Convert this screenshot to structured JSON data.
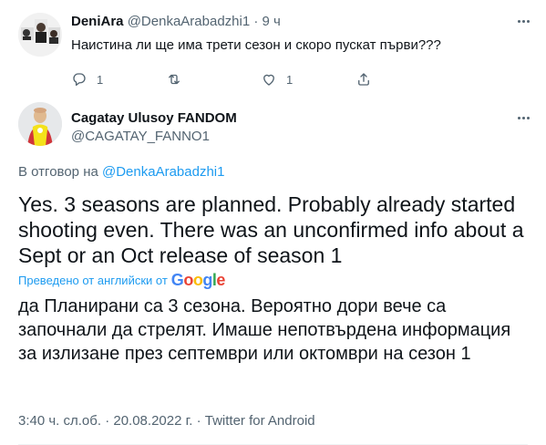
{
  "reply": {
    "name": "DeniAra",
    "handle": "@DenkaArabadzhi1",
    "separator": "·",
    "time": "9 ч",
    "text": "Наистина ли ще има трети сезон и скоро пускат първи???",
    "actions": {
      "reply_count": "1",
      "retweet_count": "",
      "like_count": "1"
    }
  },
  "tweet": {
    "name": "Cagatay Ulusoy FANDOM",
    "handle": "@CAGATAY_FANNO1",
    "replying_prefix": "В отговор на",
    "replying_mention": "@DenkaArabadzhi1",
    "text": "Yes. 3 seasons are planned. Probably already started shooting even. There was an unconfirmed info about a Sept or an Oct release of season 1",
    "translated_label": "Преведено от английски от",
    "translated_by": "Google",
    "translated_text": "да Планирани са 3 сезона. Вероятно дори вече са започнали да стрелят. Имаше непотвърдена информация за излизане през септември или октомври на сезон 1",
    "timestamp": "3:40 ч. сл.об. · 20.08.2022 г. · Twitter for Android"
  },
  "icons": {
    "reply": "reply-icon",
    "retweet": "retweet-icon",
    "like": "like-icon",
    "share": "share-icon",
    "more": "more-icon"
  },
  "colors": {
    "text": "#0f1419",
    "secondary": "#536471",
    "link": "#1d9bf0"
  }
}
